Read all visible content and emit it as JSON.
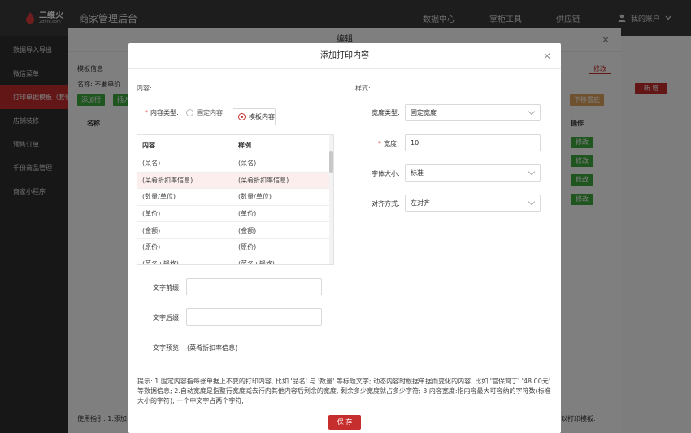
{
  "topbar": {
    "logo_main": "二维火",
    "logo_sub": "2dfire.com",
    "app_title": "商家管理后台",
    "nav": [
      "数据中心",
      "掌柜工具",
      "供应链"
    ],
    "user": "我的账户"
  },
  "sidebar": {
    "items": [
      {
        "label": "数据导入导出"
      },
      {
        "label": "微信菜单"
      },
      {
        "label": "打印单据模板（套餐）"
      },
      {
        "label": "店铺装修"
      },
      {
        "label": "预售订单"
      },
      {
        "label": "千份商品管理"
      },
      {
        "label": "商家小程序"
      }
    ]
  },
  "outer": {
    "title": "编辑",
    "template_info": "模板信息",
    "name_label": "名称: 不要单价",
    "add_row": "添加行",
    "insert": "插入",
    "col_name": "名称",
    "col_op": "操作",
    "edit_label": "修改",
    "new_label": "新 增",
    "move_down": "下移置底",
    "guide": "使用指引: 1.添加",
    "footer_right": "以打印模板."
  },
  "dialog": {
    "title": "添加打印内容",
    "content_section": "内容:",
    "style_section": "样式:",
    "content_type_label": "内容类型:",
    "radio_fixed": "固定内容",
    "radio_template": "模板内容",
    "table": {
      "headers": [
        "内容",
        "样例"
      ],
      "rows": [
        [
          "(菜名)",
          "(菜名)"
        ],
        [
          "(菜肴折扣率信息)",
          "(菜肴折扣率信息)"
        ],
        [
          "(数量/单位)",
          "(数量/单位)"
        ],
        [
          "(单价)",
          "(单价)"
        ],
        [
          "(金额)",
          "(金额)"
        ],
        [
          "(原价)",
          "(原价)"
        ],
        [
          "(菜名+规格)",
          "(菜名+规格)"
        ]
      ]
    },
    "prefix_label": "文字前缀:",
    "prefix_value": "",
    "suffix_label": "文字后缀:",
    "suffix_value": "",
    "preview_label": "文字预览:",
    "preview_value": "(菜肴折扣率信息)",
    "width_type_label": "宽度类型:",
    "width_type_value": "固定宽度",
    "width_label": "宽度:",
    "width_value": "10",
    "font_size_label": "字体大小:",
    "font_size_value": "标准",
    "align_label": "对齐方式:",
    "align_value": "左对齐",
    "tip": "提示: 1.固定内容指每张单据上不变的打印内容, 比如 '品名' 与 '数量' 等标题文字; 动态内容时根据单据而变化的内容, 比如 '宫保鸡丁' '48.00元' 等数据信息; 2.自动宽度是指整行宽度减去行内其他内容后剩余的宽度, 剩余多少宽度就占多少字符; 3.内容宽度:指内容最大可容纳的字符数(标准大小的字符), 一个中文字占两个字符;",
    "save_label": "保 存"
  },
  "colors": {
    "accent": "#c62d2d",
    "green": "#3eaa3e"
  }
}
